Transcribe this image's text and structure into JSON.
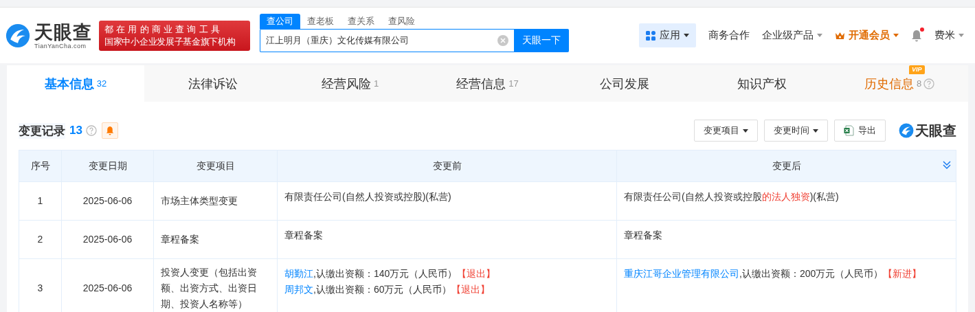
{
  "header": {
    "logo": {
      "name": "天眼查",
      "domain": "TianYanCha.com"
    },
    "slogan": [
      "都在用的商业查询工具",
      "国家中小企业发展子基金旗下机构"
    ],
    "search_tabs": [
      {
        "label": "查公司",
        "selected": true
      },
      {
        "label": "查老板",
        "selected": false
      },
      {
        "label": "查关系",
        "selected": false
      },
      {
        "label": "查风险",
        "selected": false
      }
    ],
    "search": {
      "value": "江上明月（重庆）文化传媒有限公司",
      "button": "天眼一下"
    },
    "nav": [
      {
        "kind": "apps",
        "label": "应用",
        "dropdown": true
      },
      {
        "kind": "plain",
        "label": "商务合作",
        "dropdown": false
      },
      {
        "kind": "plain",
        "label": "企业级产品",
        "dropdown": true
      },
      {
        "kind": "vip",
        "label": "开通会员",
        "dropdown": true
      },
      {
        "kind": "bell",
        "unread": true
      },
      {
        "kind": "plain",
        "label": "费米",
        "dropdown": true
      }
    ]
  },
  "tabs": [
    {
      "label": "基本信息",
      "count": "32",
      "selected": true,
      "kind": "normal"
    },
    {
      "label": "法律诉讼",
      "selected": false,
      "kind": "normal"
    },
    {
      "label": "经营风险",
      "count": "1",
      "selected": false,
      "kind": "normal"
    },
    {
      "label": "经营信息",
      "count": "17",
      "selected": false,
      "kind": "normal"
    },
    {
      "label": "公司发展",
      "selected": false,
      "kind": "normal"
    },
    {
      "label": "知识产权",
      "selected": false,
      "kind": "normal"
    },
    {
      "label": "历史信息",
      "count": "8",
      "selected": false,
      "kind": "vip",
      "badge": "VIP"
    }
  ],
  "section": {
    "title": "变更记录",
    "count": "13",
    "filters": [
      "变更项目",
      "变更时间"
    ],
    "export": "导出",
    "brand": "天眼查"
  },
  "table": {
    "columns": [
      "序号",
      "变更日期",
      "变更项目",
      "变更前",
      "变更后"
    ],
    "rows": [
      {
        "index": "1",
        "date": "2025-06-06",
        "item": "市场主体类型变更",
        "before": [
          [
            {
              "kind": "text",
              "text": "有限责任公司(自然人投资或控股)(私营)"
            }
          ]
        ],
        "after": [
          [
            {
              "kind": "text",
              "text": "有限责任公司(自然人投资或控股"
            },
            {
              "kind": "diff",
              "text": "的法人独资"
            },
            {
              "kind": "text",
              "text": ")(私营)"
            }
          ]
        ]
      },
      {
        "index": "2",
        "date": "2025-06-06",
        "item": "章程备案",
        "before": [
          [
            {
              "kind": "text",
              "text": "章程备案"
            }
          ]
        ],
        "after": [
          [
            {
              "kind": "text",
              "text": "章程备案"
            }
          ]
        ]
      },
      {
        "index": "3",
        "date": "2025-06-06",
        "item": "投资人变更（包括出资额、出资方式、出资日期、投资人名称等）",
        "before": [
          [
            {
              "kind": "link",
              "text": "胡勤江"
            },
            {
              "kind": "text",
              "text": ",认缴出资额：140万元（人民币）"
            },
            {
              "kind": "tag",
              "text": "【退出】"
            }
          ],
          [
            {
              "kind": "link",
              "text": "周邦文"
            },
            {
              "kind": "text",
              "text": ",认缴出资额：60万元（人民币）"
            },
            {
              "kind": "tag",
              "text": "【退出】"
            }
          ]
        ],
        "after": [
          [
            {
              "kind": "link",
              "text": "重庆江哥企业管理有限公司"
            },
            {
              "kind": "text",
              "text": ",认缴出资额：200万元（人民币）"
            },
            {
              "kind": "tag",
              "text": "【新进】"
            }
          ]
        ]
      }
    ]
  }
}
